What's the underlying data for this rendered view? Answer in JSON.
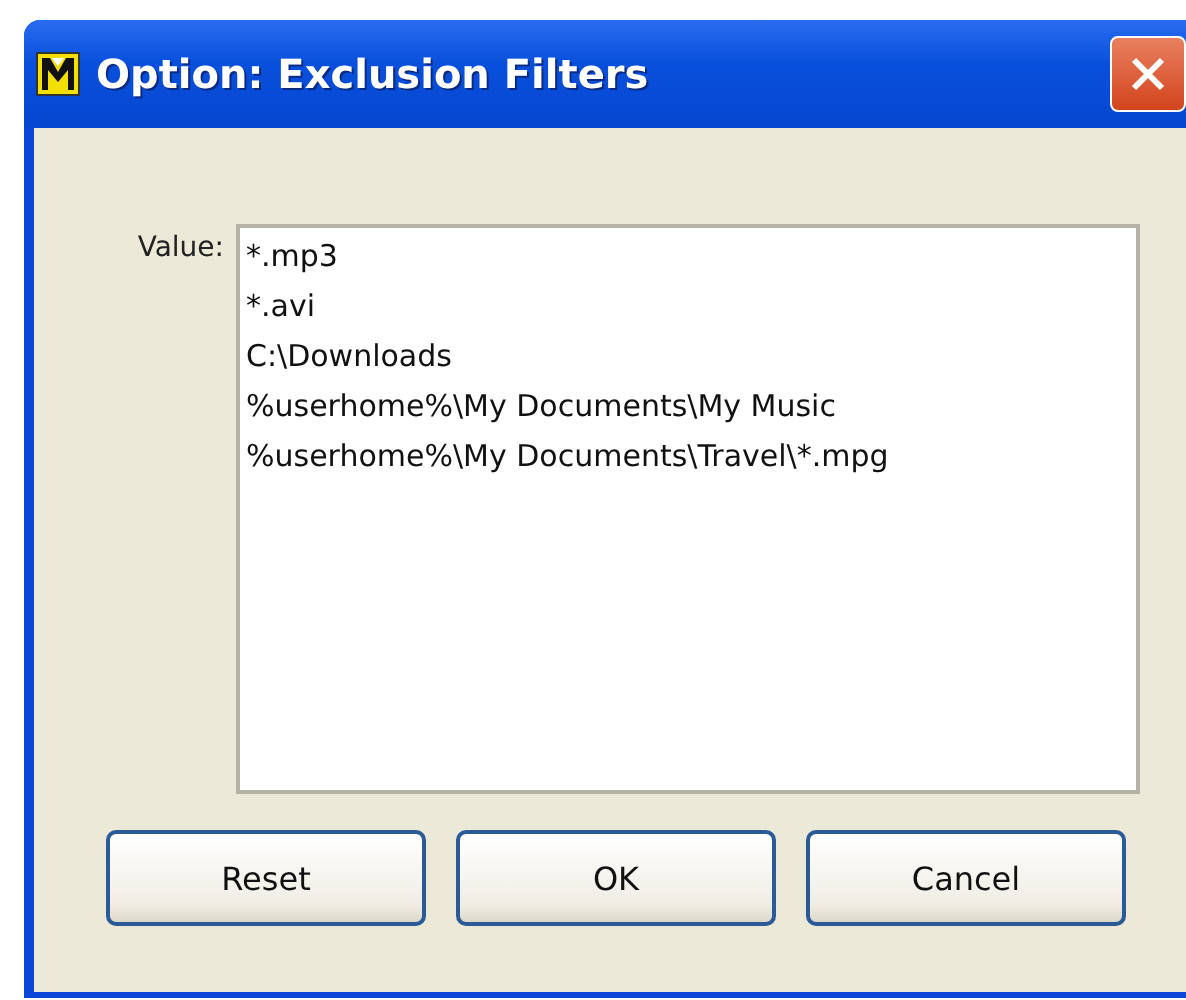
{
  "window": {
    "title": "Option: Exclusion Filters"
  },
  "field": {
    "label": "Value:",
    "value": "*.mp3\n*.avi\nC:\\Downloads\n%userhome%\\My Documents\\My Music\n%userhome%\\My Documents\\Travel\\*.mpg"
  },
  "buttons": [
    "Reset",
    "OK",
    "Cancel"
  ]
}
